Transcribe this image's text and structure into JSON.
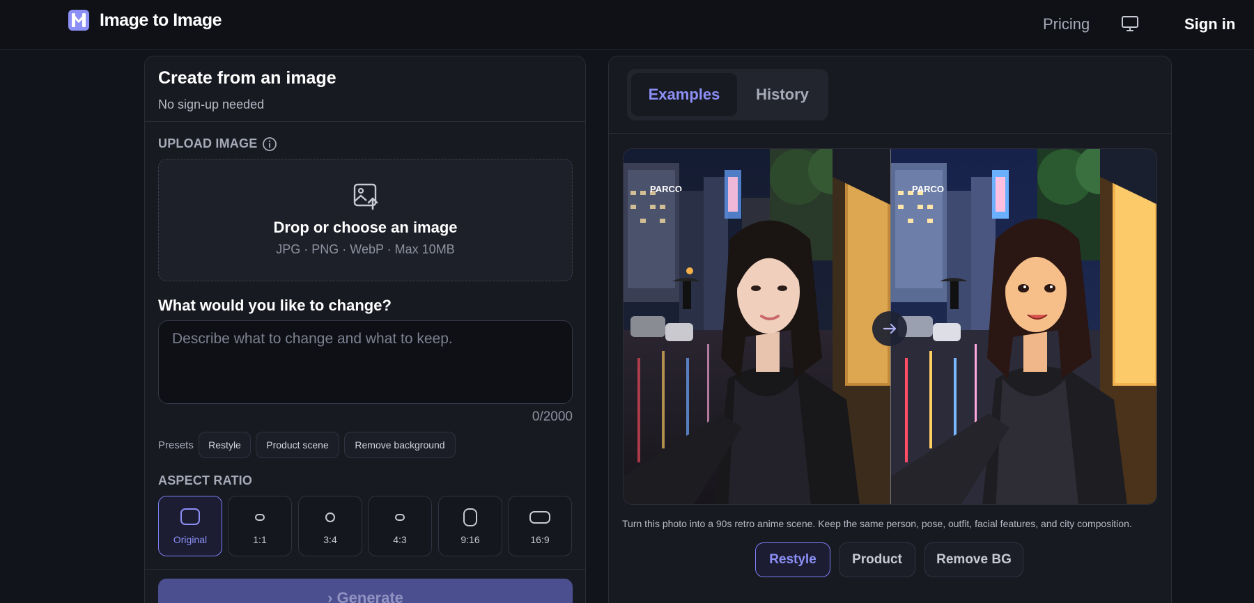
{
  "header": {
    "brand": "Image to Image",
    "nav_pricing": "Pricing",
    "nav_signin": "Sign in",
    "icons": {
      "logo": "brand-logo-icon",
      "theme": "monitor-icon"
    },
    "accent_color": "#8c8ff5"
  },
  "create_panel": {
    "title": "Create from an image",
    "subtitle": "No sign-up needed",
    "upload": {
      "label": "UPLOAD IMAGE",
      "drop_title": "Drop or choose an image",
      "drop_hint": "JPG · PNG · WebP · Max 10MB"
    },
    "change": {
      "label": "What would you like to change?",
      "placeholder": "Describe what to change and what to keep.",
      "value": "",
      "counter": "0/2000"
    },
    "presets": {
      "label": "Presets",
      "items": [
        "Restyle",
        "Product scene",
        "Remove background"
      ]
    },
    "aspect_ratio": {
      "label": "ASPECT RATIO",
      "options": [
        "Original",
        "1:1",
        "3:4",
        "4:3",
        "9:16",
        "16:9"
      ],
      "selected": "Original"
    },
    "generate_label": "Generate"
  },
  "examples_panel": {
    "tabs": [
      "Examples",
      "History"
    ],
    "active_tab": "Examples",
    "caption": "Turn this photo into a 90s retro anime scene. Keep the same person, pose, outfit, facial features, and city composition.",
    "modes": [
      "Restyle",
      "Product",
      "Remove BG"
    ],
    "active_mode": "Restyle",
    "sign_left": "PARCO",
    "sign_right": "PARCO"
  }
}
